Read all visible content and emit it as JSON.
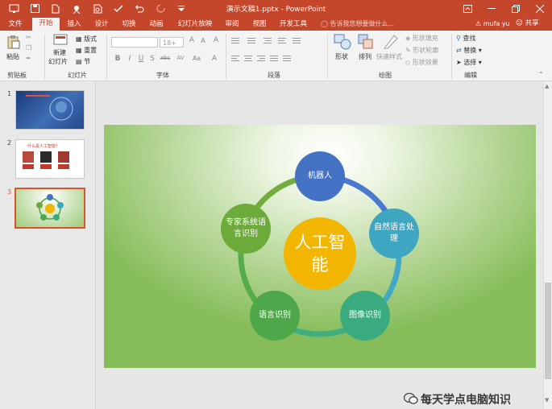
{
  "window": {
    "title": "演示文稿1.pptx - PowerPoint"
  },
  "user": {
    "name": "mufa yu"
  },
  "share_label": "共享",
  "tell_me": "告诉我您想要做什么...",
  "tabs": [
    {
      "label": "文件"
    },
    {
      "label": "开始"
    },
    {
      "label": "插入"
    },
    {
      "label": "设计"
    },
    {
      "label": "切换"
    },
    {
      "label": "动画"
    },
    {
      "label": "幻灯片放映"
    },
    {
      "label": "审阅"
    },
    {
      "label": "视图"
    },
    {
      "label": "开发工具"
    }
  ],
  "ribbon": {
    "clipboard": {
      "paste": "粘贴",
      "label": "剪贴板"
    },
    "slides": {
      "new_line1": "新建",
      "new_line2": "幻灯片",
      "layout": "版式",
      "reset": "重置",
      "section": "节",
      "label": "幻灯片"
    },
    "font": {
      "label": "字体",
      "size": "18+",
      "bold": "B",
      "italic": "I",
      "underline": "U",
      "shadow": "S",
      "strike": "abc",
      "spacing": "AV",
      "case": "Aa",
      "grow": "A",
      "shrink": "A",
      "clear": "A",
      "color": "A"
    },
    "paragraph": {
      "label": "段落"
    },
    "drawing": {
      "shapes": "形状",
      "arrange": "排列",
      "quick_styles": "快速样式",
      "fill": "形状填充",
      "outline": "形状轮廓",
      "effects": "形状效果",
      "label": "绘图"
    },
    "editing": {
      "find": "查找",
      "replace": "替换",
      "select": "选择",
      "label": "编辑"
    }
  },
  "slides_panel": [
    {
      "number": "1"
    },
    {
      "number": "2",
      "thumb_title": "什么是人工智能？"
    },
    {
      "number": "3"
    }
  ],
  "slide": {
    "center": "人工智能",
    "nodes": [
      {
        "label": "机器人",
        "color": "#4472c4"
      },
      {
        "label": "自然语言处理",
        "color": "#3fa6c2"
      },
      {
        "label": "图像识别",
        "color": "#3aab7f"
      },
      {
        "label": "语言识别",
        "color": "#4ea84a"
      },
      {
        "label": "专家系统语言识别",
        "color": "#6cab3a"
      }
    ],
    "center_color": "#f2b600"
  },
  "watermark": "每天学点电脑知识"
}
